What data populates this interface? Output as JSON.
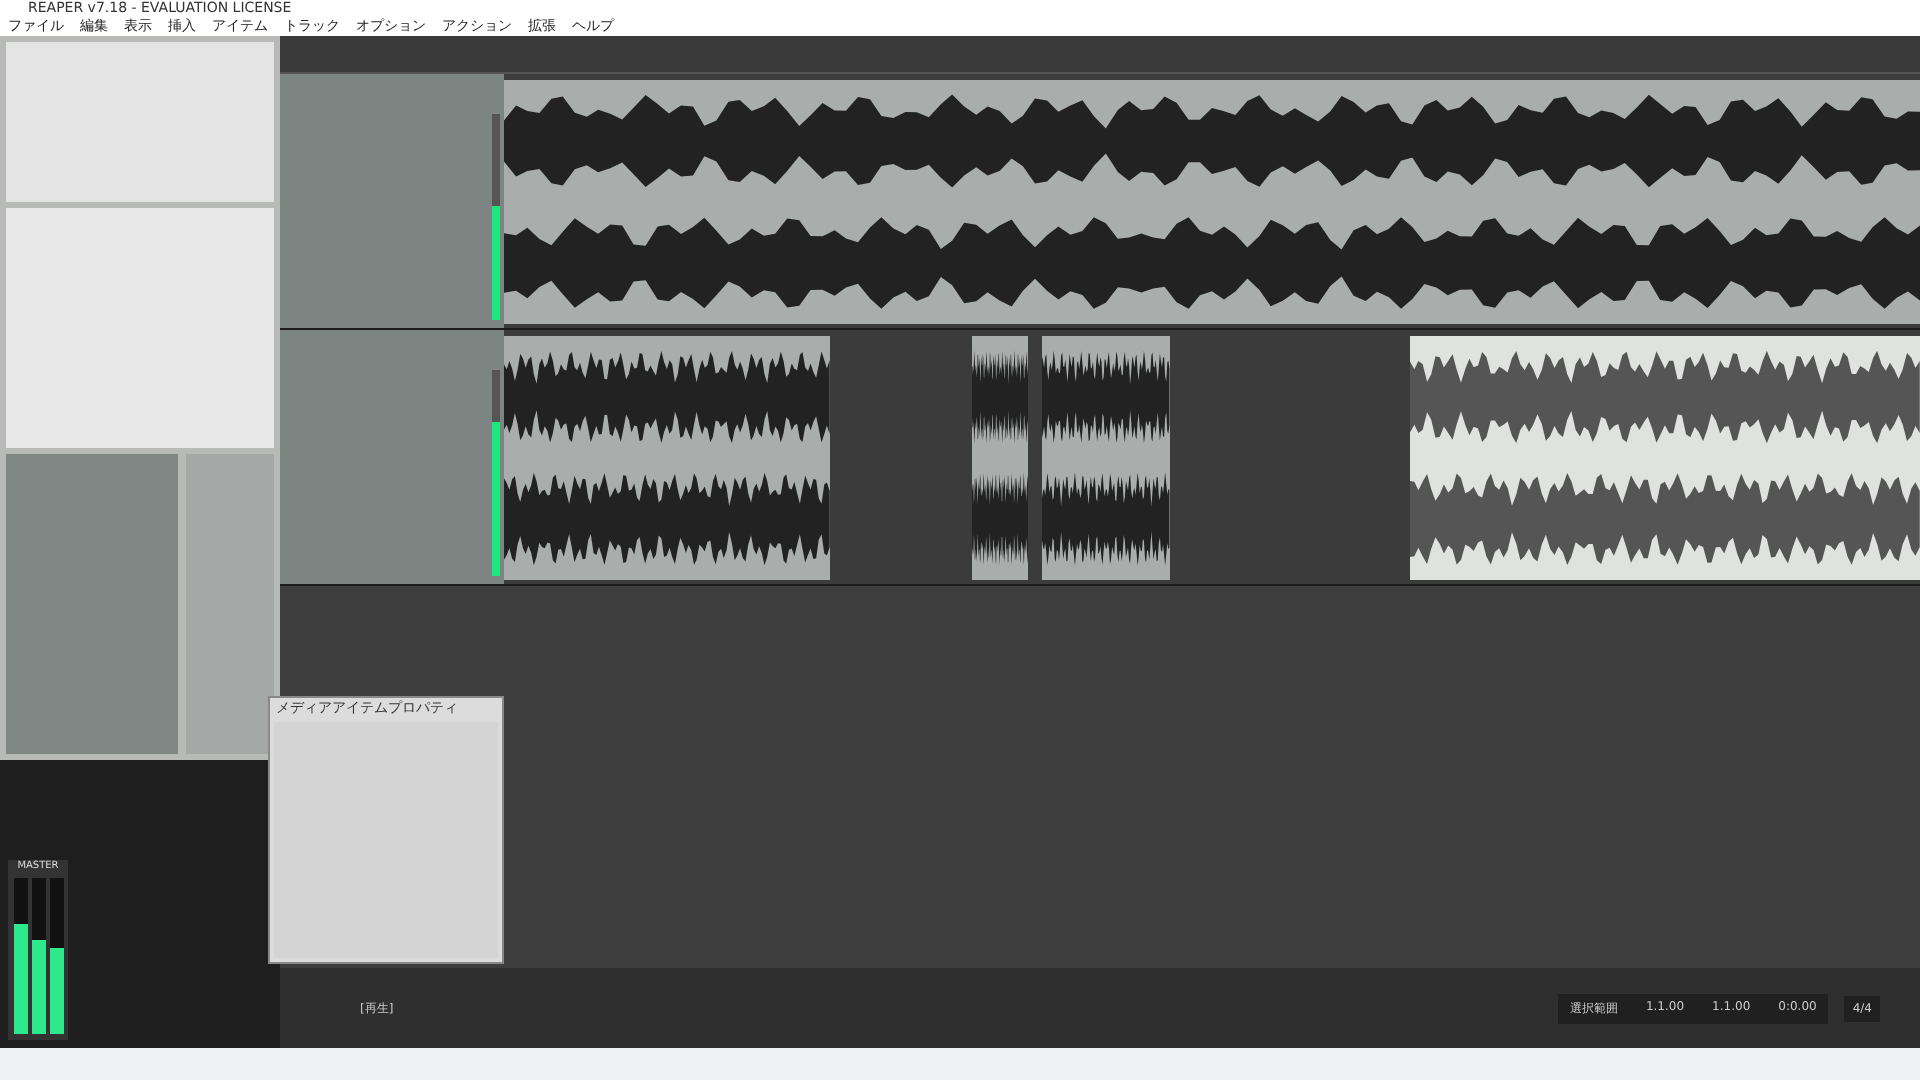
{
  "window": {
    "title": "REAPER v7.18 - EVALUATION LICENSE"
  },
  "menu": [
    "ファイル",
    "編集",
    "表示",
    "挿入",
    "アイテム",
    "トラック",
    "オプション",
    "アクション",
    "拡張",
    "ヘルプ"
  ],
  "tracks": [
    {
      "level": 0.55,
      "clips": [
        {
          "selected": false
        }
      ]
    },
    {
      "level": 0.75,
      "clips": [
        {
          "selected": false
        },
        {
          "selected": false
        },
        {
          "selected": false
        },
        {
          "selected": true
        }
      ]
    }
  ],
  "transport": {
    "state": "[再生]"
  },
  "selection": {
    "label": "選択範囲",
    "start": "1.1.00",
    "end": "1.1.00",
    "length": "0:0.00"
  },
  "time_signature": "4/4",
  "dialog": {
    "title": "メディアアイテムプロパティ"
  },
  "mixer": {
    "master_label": "MASTER",
    "meters": [
      {
        "level": 0.7
      },
      {
        "level": 0.6
      },
      {
        "level": 0.55
      }
    ]
  }
}
